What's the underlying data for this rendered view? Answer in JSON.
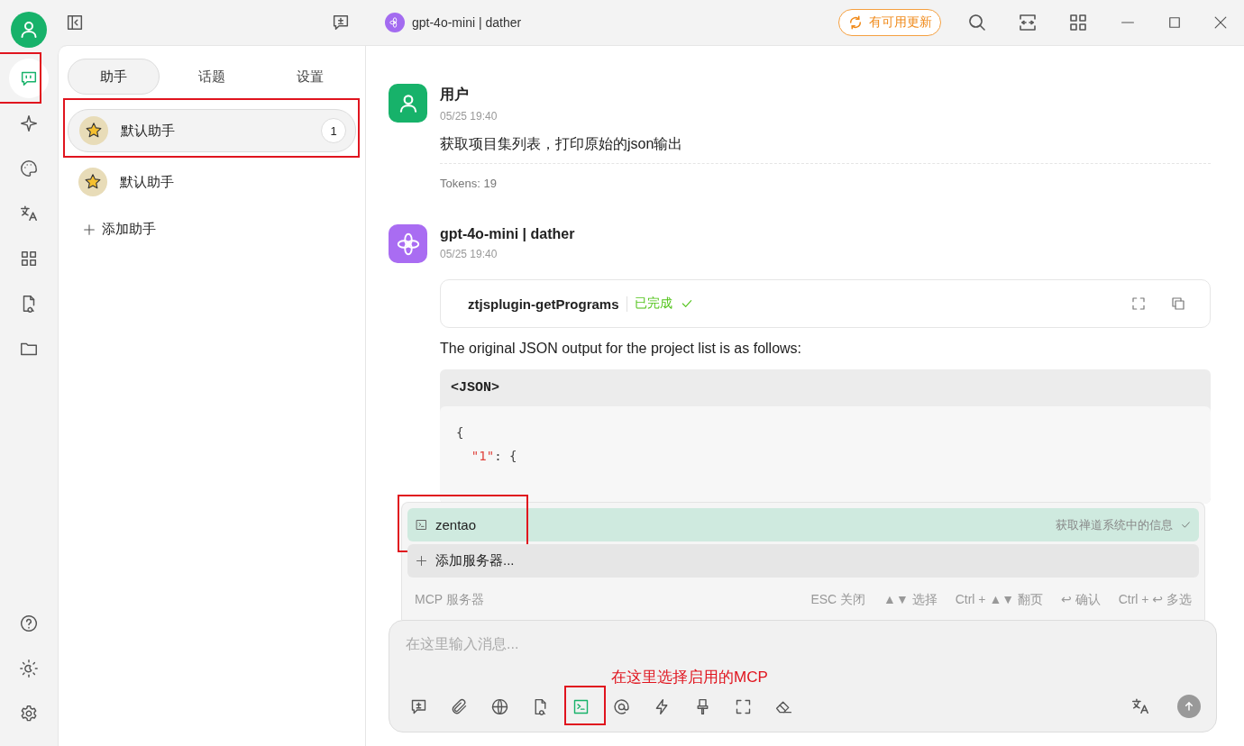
{
  "rail": {
    "items": [
      {
        "kind": "chat",
        "selected": true,
        "annotated": true
      },
      {
        "kind": "sparkle",
        "selected": false
      },
      {
        "kind": "palette",
        "selected": false
      },
      {
        "kind": "translate",
        "selected": false
      },
      {
        "kind": "apps",
        "selected": false
      },
      {
        "kind": "filesearch",
        "selected": false
      },
      {
        "kind": "folder",
        "selected": false
      }
    ],
    "bottom": [
      {
        "kind": "help"
      },
      {
        "kind": "theme"
      },
      {
        "kind": "settings"
      }
    ]
  },
  "topbar": {
    "model": "gpt-4o-mini | dather",
    "update_button": "有可用更新"
  },
  "sidebar": {
    "tabs": [
      {
        "label": "助手",
        "selected": true
      },
      {
        "label": "话题",
        "selected": false
      },
      {
        "label": "设置",
        "selected": false
      }
    ],
    "assistants": [
      {
        "name": "默认助手",
        "count": "1",
        "selected": true,
        "annotated": true
      },
      {
        "name": "默认助手",
        "selected": false
      }
    ],
    "add_label": "添加助手"
  },
  "messages": [
    {
      "kind": "user",
      "name": "用户",
      "time": "05/25 19:40",
      "text": "获取项目集列表，打印原始的json输出",
      "tokens": "Tokens: 19"
    },
    {
      "kind": "assistant",
      "name": "gpt-4o-mini | dather",
      "time": "05/25 19:40",
      "tool": {
        "name": "ztjsplugin-getPrograms",
        "status": "已完成"
      },
      "text": "The original JSON output for the project list is as follows:",
      "code": {
        "header": "<JSON>",
        "lines": [
          [
            {
              "kind": "punct",
              "text": "{"
            }
          ],
          [
            {
              "kind": "string",
              "text": "  \"1\""
            },
            {
              "kind": "punct",
              "text": ": {"
            }
          ]
        ]
      }
    }
  ],
  "mcp_popup": {
    "servers": [
      {
        "name": "zentao",
        "description": "获取禅道系统中的信息",
        "selected": true,
        "annotated": true
      }
    ],
    "add_label": "添加服务器...",
    "footer_label": "MCP 服务器",
    "hints": [
      "ESC 关闭",
      "▲▼ 选择",
      "Ctrl + ▲▼ 翻页",
      "↩ 确认",
      "Ctrl + ↩ 多选"
    ]
  },
  "input": {
    "placeholder": "在这里输入消息...",
    "tools": [
      {
        "kind": "newtopic",
        "selected": false
      },
      {
        "kind": "attach",
        "selected": false
      },
      {
        "kind": "globe",
        "selected": false
      },
      {
        "kind": "filesearch",
        "selected": false
      },
      {
        "kind": "terminal",
        "selected": true,
        "annotated": true
      },
      {
        "kind": "at",
        "selected": false
      },
      {
        "kind": "bolt",
        "selected": false
      },
      {
        "kind": "brush",
        "selected": false
      },
      {
        "kind": "fullscreen",
        "selected": false
      },
      {
        "kind": "eraser",
        "selected": false
      }
    ],
    "annotation_caption": "在这里选择启用的MCP"
  }
}
